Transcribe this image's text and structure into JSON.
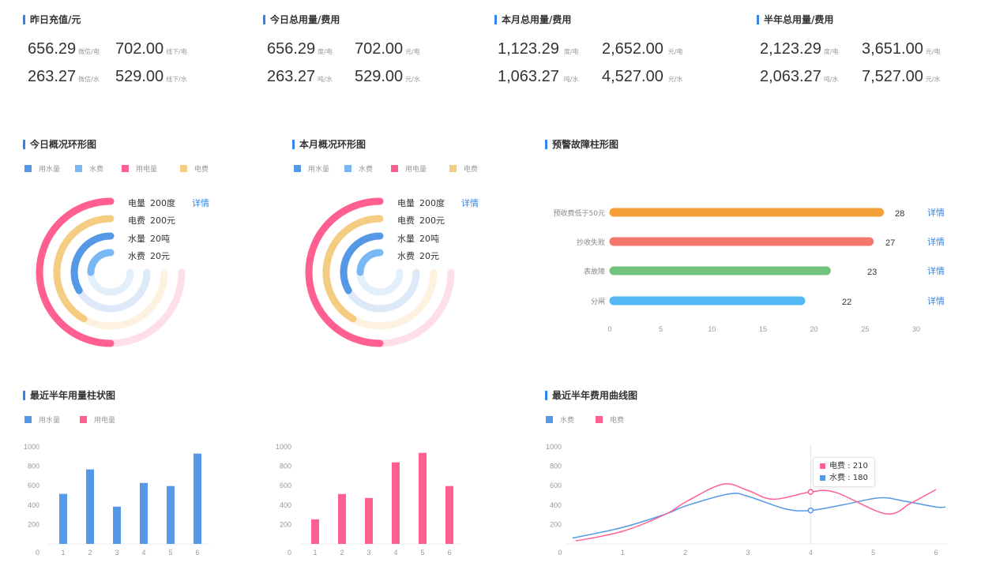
{
  "colors": {
    "accent": "#2f86e8",
    "water_usage": "#5599e6",
    "water_fee": "#7ab8f5",
    "elec_usage": "#ff6090",
    "elec_fee": "#f5cd82",
    "water_usage_bg": "#dde9f9",
    "water_fee_bg": "#e4effc",
    "elec_usage_bg": "#ffdfe7",
    "elec_fee_bg": "#fdf2e0",
    "fault_orange": "#f6a03c",
    "fault_red": "#f4786b",
    "fault_green": "#74c27f",
    "fault_blue": "#55b8f4"
  },
  "kpis": [
    {
      "title": "昨日充值/元",
      "rows": [
        [
          {
            "value": "656.29",
            "unit": "微信/电"
          },
          {
            "value": "702.00",
            "unit": "线下/电"
          }
        ],
        [
          {
            "value": "263.27",
            "unit": "微信/水"
          },
          {
            "value": "529.00",
            "unit": "线下/水"
          }
        ]
      ]
    },
    {
      "title": "今日总用量/费用",
      "rows": [
        [
          {
            "value": "656.29",
            "unit": "度/电"
          },
          {
            "value": "702.00",
            "unit": "元/电"
          }
        ],
        [
          {
            "value": "263.27",
            "unit": "吨/水"
          },
          {
            "value": "529.00",
            "unit": "元/水"
          }
        ]
      ]
    },
    {
      "title": "本月总用量/费用",
      "rows": [
        [
          {
            "value": "1,123.29",
            "unit": "度/电"
          },
          {
            "value": "2,652.00",
            "unit": "元/电"
          }
        ],
        [
          {
            "value": "1,063.27",
            "unit": "吨/水"
          },
          {
            "value": "4,527.00",
            "unit": "元/水"
          }
        ]
      ]
    },
    {
      "title": "半年总用量/费用",
      "rows": [
        [
          {
            "value": "2,123.29",
            "unit": "度/电"
          },
          {
            "value": "3,651.00",
            "unit": "元/电"
          }
        ],
        [
          {
            "value": "2,063.27",
            "unit": "吨/水"
          },
          {
            "value": "7,527.00",
            "unit": "元/水"
          }
        ]
      ]
    }
  ],
  "rings": [
    {
      "title": "今日概况环形图",
      "legend": [
        "用水量",
        "水费",
        "用电量",
        "电费"
      ],
      "labels": [
        {
          "name": "电量",
          "value": "200度"
        },
        {
          "name": "电费",
          "value": "200元"
        },
        {
          "name": "水量",
          "value": "20吨"
        },
        {
          "name": "水费",
          "value": "20元"
        }
      ],
      "fractions": [
        0.6667,
        0.5556,
        0.4444,
        0.3333
      ],
      "detail_link": "详情"
    },
    {
      "title": "本月概况环形图",
      "legend": [
        "用水量",
        "水费",
        "用电量",
        "电费"
      ],
      "labels": [
        {
          "name": "电量",
          "value": "200度"
        },
        {
          "name": "电费",
          "value": "200元"
        },
        {
          "name": "水量",
          "value": "20吨"
        },
        {
          "name": "水费",
          "value": "20元"
        }
      ],
      "fractions": [
        0.6667,
        0.5556,
        0.4444,
        0.3333
      ],
      "detail_link": "详情"
    }
  ],
  "chart_data": [
    {
      "id": "fault",
      "type": "bar",
      "orientation": "horizontal",
      "title": "预警故障柱形图",
      "categories": [
        "预收费低于50元",
        "抄收失败",
        "表故障",
        "分闸"
      ],
      "values": [
        28,
        27,
        23,
        22
      ],
      "bar_extent": [
        26.8,
        25.8,
        21.6,
        19.1
      ],
      "xlim": [
        0,
        30
      ],
      "xticks": [
        0,
        5,
        10,
        15,
        20,
        25,
        30
      ],
      "detail_link": "详情",
      "grid": false
    },
    {
      "id": "water_usage",
      "type": "bar",
      "title": "最近半年用量柱状图",
      "legend": [
        "用水量",
        "用电量"
      ],
      "categories": [
        "1",
        "2",
        "3",
        "4",
        "5",
        "6"
      ],
      "values": [
        515,
        767,
        384,
        628,
        596,
        930
      ],
      "ylim": [
        0,
        1000
      ],
      "yticks": [
        0,
        200,
        400,
        600,
        800,
        1000
      ],
      "grid": false
    },
    {
      "id": "elec_usage",
      "type": "bar",
      "title": "",
      "categories": [
        "1",
        "2",
        "3",
        "4",
        "5",
        "6"
      ],
      "values": [
        253,
        514,
        473,
        840,
        938,
        596
      ],
      "ylim": [
        0,
        1000
      ],
      "yticks": [
        0,
        200,
        400,
        600,
        800,
        1000
      ],
      "grid": false
    },
    {
      "id": "fee_curve",
      "type": "line",
      "title": "最近半年费用曲线图",
      "legend": [
        "水费",
        "电费"
      ],
      "xlim": [
        0,
        6.15
      ],
      "xticks": [
        0,
        1,
        2,
        3,
        4,
        5,
        6
      ],
      "ylim": [
        0,
        1000
      ],
      "yticks": [
        0,
        200,
        400,
        600,
        800,
        1000
      ],
      "series": [
        {
          "name": "水费",
          "x": [
            0.2,
            1,
            1.7,
            2,
            2.7,
            3,
            3.6,
            4,
            4.5,
            5.1,
            5.5,
            6,
            6.15
          ],
          "y": [
            60,
            170,
            310,
            390,
            515,
            490,
            360,
            345,
            400,
            475,
            440,
            380,
            380
          ]
        },
        {
          "name": "电费",
          "x": [
            0.25,
            1,
            1.7,
            2,
            2.6,
            3,
            3.4,
            4,
            4.4,
            5.2,
            5.6,
            6
          ],
          "y": [
            30,
            130,
            310,
            430,
            615,
            550,
            460,
            535,
            530,
            310,
            420,
            560
          ]
        }
      ],
      "highlight_x": 4,
      "tooltip": [
        {
          "name": "电费",
          "value": "210"
        },
        {
          "name": "水费",
          "value": "180"
        }
      ],
      "grid": false
    }
  ]
}
